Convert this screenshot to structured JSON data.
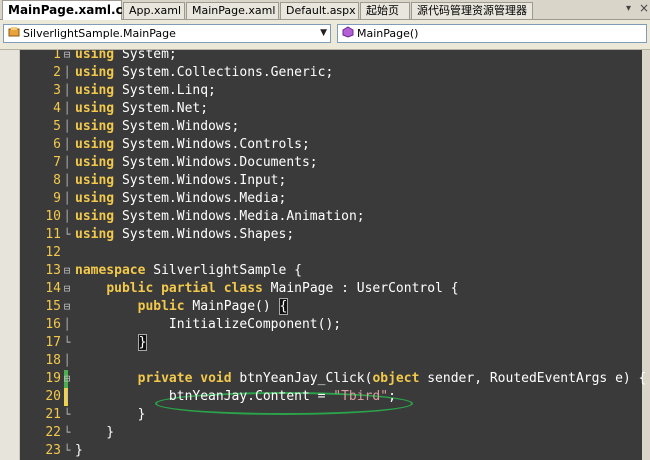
{
  "tabs": [
    {
      "label": "MainPage.xaml.cs",
      "active": true
    },
    {
      "label": "App.xaml",
      "active": false
    },
    {
      "label": "MainPage.xaml",
      "active": false
    },
    {
      "label": "Default.aspx",
      "active": false
    },
    {
      "label": "起始页",
      "active": false
    },
    {
      "label": "源代码管理资源管理器",
      "active": false
    }
  ],
  "tab_controls": {
    "dropdown_icon": "chevron-down-icon",
    "close_icon": "close-icon",
    "close_label": "×",
    "dropdown_label": "▾"
  },
  "navbar": {
    "type_combo": {
      "value": "SilverlightSample.MainPage",
      "icon": "class-icon"
    },
    "member_combo": {
      "value": "MainPage()",
      "icon": "method-icon"
    }
  },
  "colors": {
    "keyword": "#f2c94c",
    "line_number": "#f2c94c",
    "editor_bg": "#3a3a3a",
    "changed": "#f2d24a",
    "saved": "#4caf50",
    "annotation": "#2aa34a"
  },
  "code_lines": [
    {
      "n": "1",
      "fold": "⊟",
      "html": "<span class=\"kw\">using</span> System;"
    },
    {
      "n": "2",
      "fold": "│",
      "html": "<span class=\"kw\">using</span> System.Collections.Generic;"
    },
    {
      "n": "3",
      "fold": "│",
      "html": "<span class=\"kw\">using</span> System.Linq;"
    },
    {
      "n": "4",
      "fold": "│",
      "html": "<span class=\"kw\">using</span> System.Net;"
    },
    {
      "n": "5",
      "fold": "│",
      "html": "<span class=\"kw\">using</span> System.Windows;"
    },
    {
      "n": "6",
      "fold": "│",
      "html": "<span class=\"kw\">using</span> System.Windows.Controls;"
    },
    {
      "n": "7",
      "fold": "│",
      "html": "<span class=\"kw\">using</span> System.Windows.Documents;"
    },
    {
      "n": "8",
      "fold": "│",
      "html": "<span class=\"kw\">using</span> System.Windows.Input;"
    },
    {
      "n": "9",
      "fold": "│",
      "html": "<span class=\"kw\">using</span> System.Windows.Media;"
    },
    {
      "n": "10",
      "fold": "│",
      "html": "<span class=\"kw\">using</span> System.Windows.Media.Animation;"
    },
    {
      "n": "11",
      "fold": "└",
      "html": "<span class=\"kw\">using</span> System.Windows.Shapes;"
    },
    {
      "n": "12",
      "fold": "",
      "html": ""
    },
    {
      "n": "13",
      "fold": "⊟",
      "html": "<span class=\"kw\">namespace</span> SilverlightSample {"
    },
    {
      "n": "14",
      "fold": "⊟",
      "html": "    <span class=\"kw\">public partial class</span> MainPage : UserControl {"
    },
    {
      "n": "15",
      "fold": "⊟",
      "html": "        <span class=\"kw\">public</span> MainPage() <span class=\"caret\">{</span>"
    },
    {
      "n": "16",
      "fold": "│",
      "html": "            InitializeComponent();"
    },
    {
      "n": "17",
      "fold": "└",
      "html": "        <span class=\"caret\">}</span>"
    },
    {
      "n": "18",
      "fold": "│",
      "html": ""
    },
    {
      "n": "19",
      "fold": "⊟",
      "html": "        <span class=\"kw\">private void</span> btnYeanJay_Click(<span class=\"kw\">object</span> sender, RoutedEventArgs e) {"
    },
    {
      "n": "20",
      "fold": "│",
      "html": "            btnYeanJay.Content = <span class=\"str\">\"Tbird\"</span>;"
    },
    {
      "n": "21",
      "fold": "└",
      "html": "        }"
    },
    {
      "n": "22",
      "fold": "└",
      "html": "    }"
    },
    {
      "n": "23",
      "fold": "└",
      "html": "}"
    }
  ],
  "change_marks": {
    "19": "saved",
    "20": "changed"
  }
}
